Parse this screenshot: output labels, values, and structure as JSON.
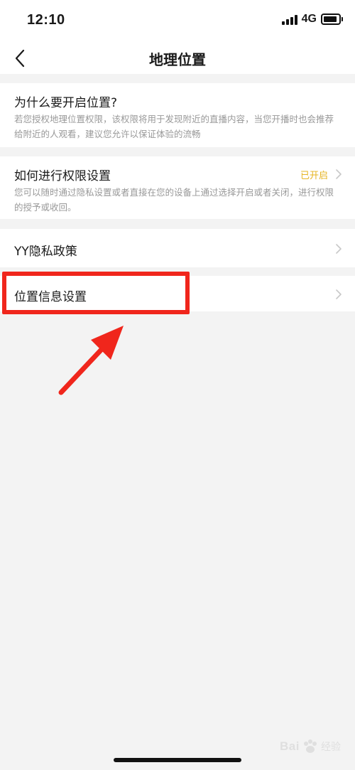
{
  "status_bar": {
    "time": "12:10",
    "network": "4G"
  },
  "nav": {
    "title": "地理位置"
  },
  "sections": {
    "why": {
      "title": "为什么要开启位置?",
      "desc": "若您授权地理位置权限，该权限将用于发现附近的直播内容，当您开播时也会推荐给附近的人观看，建议您允许以保证体验的流畅"
    },
    "permission": {
      "title": "如何进行权限设置",
      "status": "已开启",
      "desc": "您可以随时通过隐私设置或者直接在您的设备上通过选择开启或者关闭，进行权限的授予或收回。"
    },
    "privacy": {
      "title": "YY隐私政策"
    },
    "location_info": {
      "title": "位置信息设置"
    }
  },
  "colors": {
    "accent_enabled": "#e6b422",
    "annotation": "#f0261c"
  },
  "watermark": {
    "brand": "Bai",
    "suffix": "经验"
  }
}
